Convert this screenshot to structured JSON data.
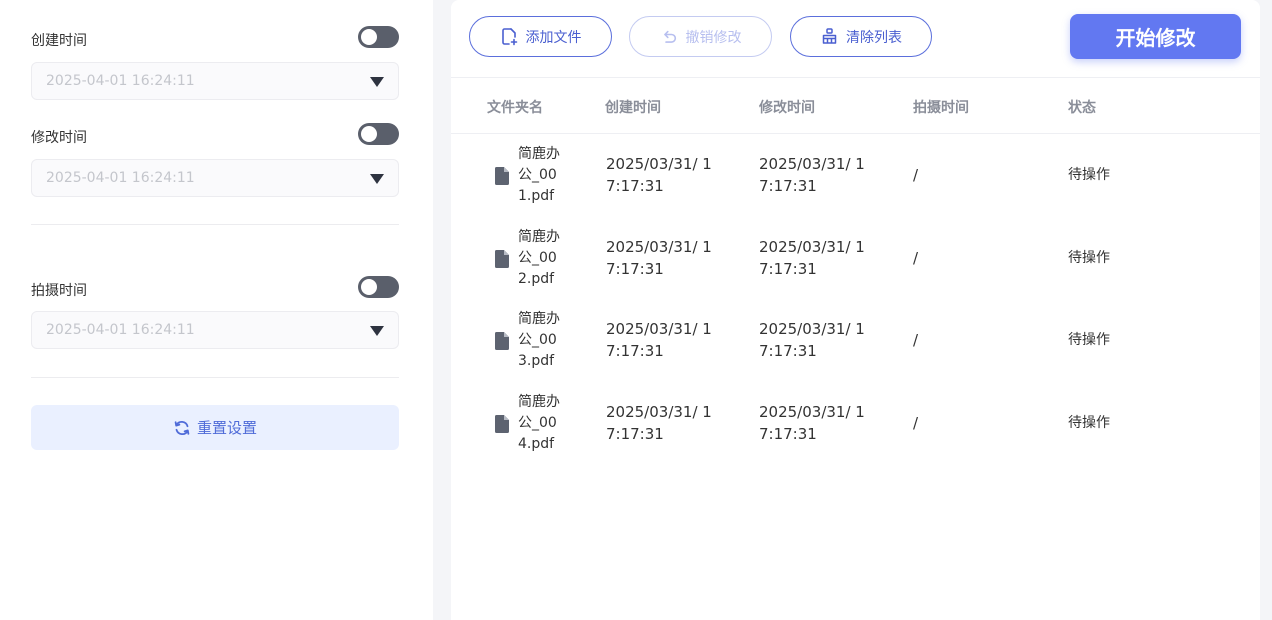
{
  "settings": {
    "create_time": {
      "label": "创建时间",
      "value": "2025-04-01 16:24:11"
    },
    "modify_time": {
      "label": "修改时间",
      "value": "2025-04-01 16:24:11"
    },
    "shoot_time": {
      "label": "拍摄时间",
      "value": "2025-04-01 16:24:11"
    },
    "reset_label": "重置设置"
  },
  "toolbar": {
    "add_label": "添加文件",
    "undo_label": "撤销修改",
    "clear_label": "清除列表",
    "start_label": "开始修改"
  },
  "table": {
    "headers": [
      "文件夹名",
      "创建时间",
      "修改时间",
      "拍摄时间",
      "状态"
    ],
    "rows": [
      {
        "name_lines": [
          "简鹿办",
          "公_00",
          "1.pdf"
        ],
        "created": [
          "2025/03/31/ 1",
          "7:17:31"
        ],
        "modified": [
          "2025/03/31/ 1",
          "7:17:31"
        ],
        "shot": "/",
        "status": "待操作"
      },
      {
        "name_lines": [
          "简鹿办",
          "公_00",
          "2.pdf"
        ],
        "created": [
          "2025/03/31/ 1",
          "7:17:31"
        ],
        "modified": [
          "2025/03/31/ 1",
          "7:17:31"
        ],
        "shot": "/",
        "status": "待操作"
      },
      {
        "name_lines": [
          "简鹿办",
          "公_00",
          "3.pdf"
        ],
        "created": [
          "2025/03/31/ 1",
          "7:17:31"
        ],
        "modified": [
          "2025/03/31/ 1",
          "7:17:31"
        ],
        "shot": "/",
        "status": "待操作"
      },
      {
        "name_lines": [
          "简鹿办",
          "公_00",
          "4.pdf"
        ],
        "created": [
          "2025/03/31/ 1",
          "7:17:31"
        ],
        "modified": [
          "2025/03/31/ 1",
          "7:17:31"
        ],
        "shot": "/",
        "status": "待操作"
      }
    ]
  },
  "icons": {
    "add": "file-add-icon",
    "undo": "undo-icon",
    "clear": "broom-icon",
    "reset": "refresh-icon",
    "file": "file-icon"
  },
  "colors": {
    "accent": "#6278f1",
    "accent_text": "#4a5fd0",
    "toggle_off": "#5a5f6b"
  }
}
